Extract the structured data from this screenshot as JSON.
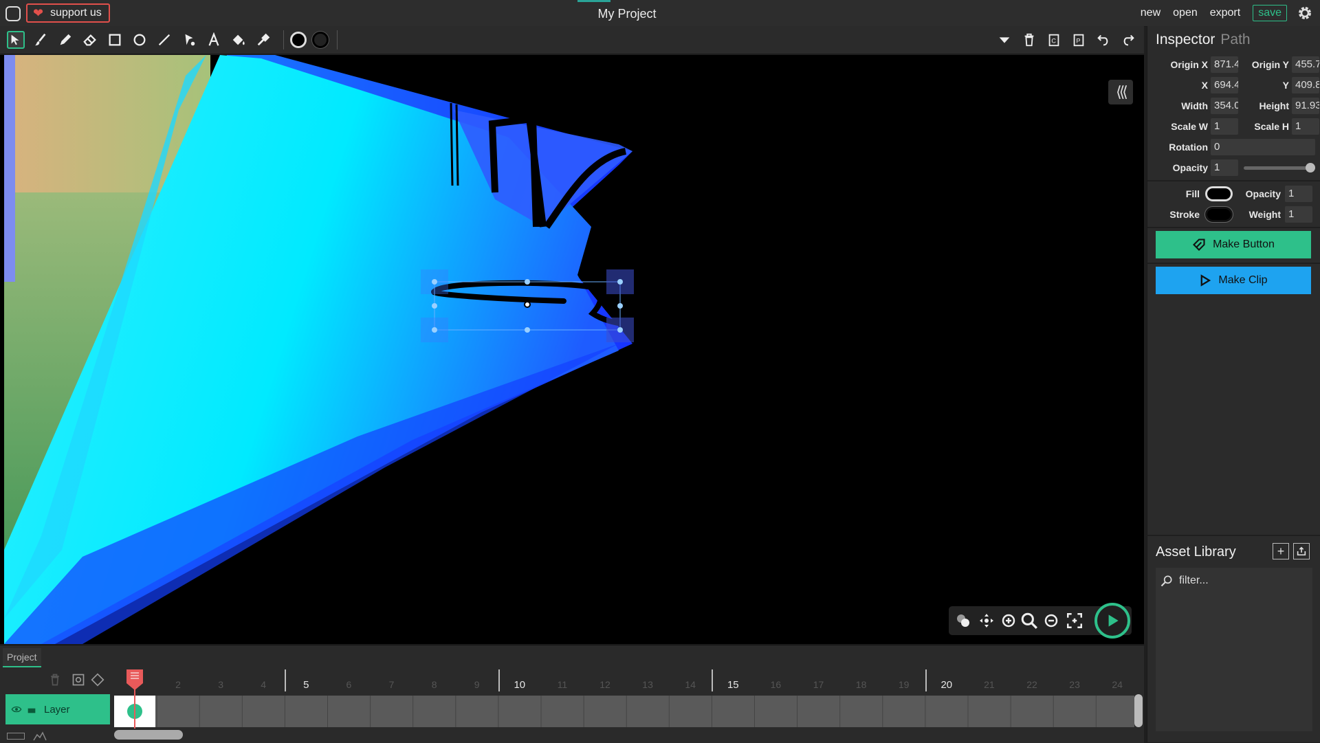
{
  "app": {
    "title": "My Project",
    "support_label": "support us",
    "menu": [
      "new",
      "open",
      "export"
    ],
    "save_label": "save"
  },
  "toolbar": {
    "tools": [
      "select-icon",
      "brush-icon",
      "pencil-icon",
      "eraser-icon",
      "rectangle-icon",
      "ellipse-icon",
      "line-icon",
      "path-icon",
      "text-icon",
      "fill-bucket-icon",
      "eyedropper-icon"
    ],
    "color_swatches": [
      "#000000",
      "#000000"
    ],
    "right_tools": [
      "chevron-down-icon",
      "trash-icon",
      "copy-icon",
      "paste-icon",
      "undo-icon",
      "redo-icon"
    ]
  },
  "inspector": {
    "title": "Inspector",
    "subtitle": "Path",
    "origin_x_label": "Origin X",
    "origin_x": "871.4",
    "origin_y_label": "Origin Y",
    "origin_y": "455.7",
    "x_label": "X",
    "x": "694.4",
    "y_label": "Y",
    "y": "409.8",
    "width_label": "Width",
    "width": "354.0",
    "height_label": "Height",
    "height": "91.93",
    "scale_w_label": "Scale W",
    "scale_w": "1",
    "scale_h_label": "Scale H",
    "scale_h": "1",
    "rotation_label": "Rotation",
    "rotation": "0",
    "opacity_label": "Opacity",
    "opacity": "1",
    "opacity_slider_value": 1,
    "fill_label": "Fill",
    "fill_color": "#000000",
    "fill_opacity_label": "Opacity",
    "fill_opacity": "1",
    "stroke_label": "Stroke",
    "stroke_color": "#000000",
    "weight_label": "Weight",
    "weight": "1",
    "make_button_label": "Make Button",
    "make_clip_label": "Make Clip"
  },
  "assets": {
    "title": "Asset Library",
    "filter_placeholder": "filter..."
  },
  "timeline": {
    "tab_label": "Project",
    "layer_name": "Layer",
    "frame_numbers": [
      "2",
      "3",
      "4",
      "5",
      "6",
      "7",
      "8",
      "9",
      "10",
      "11",
      "12",
      "13",
      "14",
      "15",
      "16",
      "17",
      "18",
      "19",
      "20",
      "21",
      "22",
      "23",
      "24"
    ],
    "major_frames": [
      "5",
      "10",
      "15",
      "20"
    ],
    "current_frame": 1
  },
  "colors": {
    "accent": "#2ec08a",
    "clip_blue": "#1ea3f0",
    "support_red": "#e2504b"
  }
}
